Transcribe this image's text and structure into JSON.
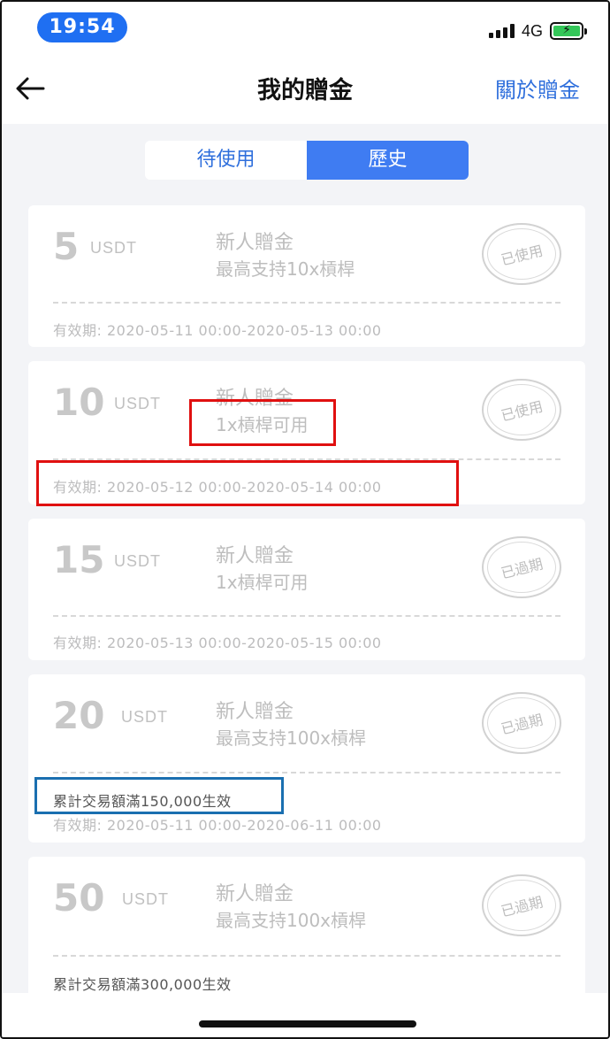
{
  "status_bar": {
    "time": "19:54",
    "network": "4G"
  },
  "nav": {
    "title": "我的贈金",
    "about_label": "關於贈金"
  },
  "tabs": [
    {
      "label": "待使用",
      "active": false
    },
    {
      "label": "歷史",
      "active": true
    }
  ],
  "vouchers": [
    {
      "amount": "5",
      "unit": "USDT",
      "title": "新人贈金",
      "subtitle": "最高支持10x槓桿",
      "status": "已使用",
      "condition": "",
      "validity": "有效期: 2020-05-11 00:00-2020-05-13 00:00"
    },
    {
      "amount": "10",
      "unit": "USDT",
      "title": "新人贈金",
      "subtitle": "1x槓桿可用",
      "status": "已使用",
      "condition": "",
      "validity": "有效期: 2020-05-12 00:00-2020-05-14 00:00"
    },
    {
      "amount": "15",
      "unit": "USDT",
      "title": "新人贈金",
      "subtitle": "1x槓桿可用",
      "status": "已過期",
      "condition": "",
      "validity": "有效期: 2020-05-13 00:00-2020-05-15 00:00"
    },
    {
      "amount": "20",
      "unit": "USDT",
      "title": "新人贈金",
      "subtitle": "最高支持100x槓桿",
      "status": "已過期",
      "condition": "累計交易額滿150,000生效",
      "validity": "有效期: 2020-05-11 00:00-2020-06-11 00:00"
    },
    {
      "amount": "50",
      "unit": "USDT",
      "title": "新人贈金",
      "subtitle": "最高支持100x槓桿",
      "status": "已過期",
      "condition": "累計交易額滿300,000生效",
      "validity": ""
    }
  ],
  "colors": {
    "accent": "#3f7cf2",
    "link": "#2f6fdc",
    "highlight_red": "#e01010",
    "highlight_blue": "#1a6fb0"
  }
}
